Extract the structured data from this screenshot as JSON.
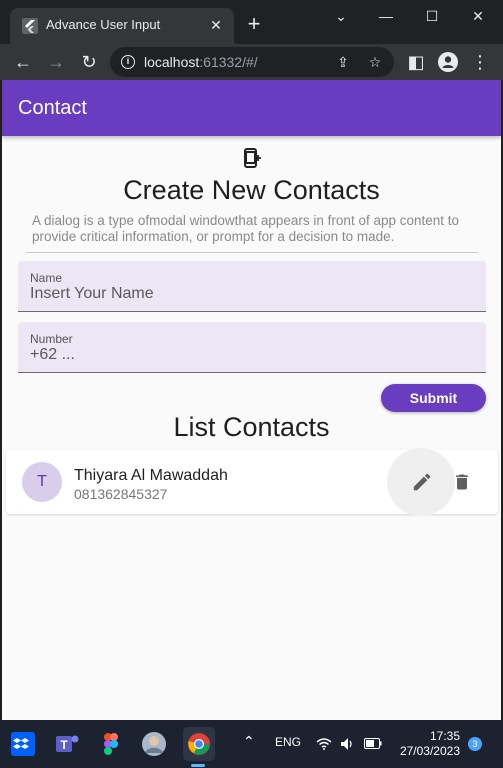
{
  "browser": {
    "tab_title": "Advance User Input",
    "url_host": "localhost",
    "url_rest": ":61332/#/"
  },
  "app": {
    "appbar_title": "Contact",
    "hero_title": "Create New Contacts",
    "hero_description": "A dialog is a type ofmodal windowthat appears in front of app content to provide critical information, or prompt for a decision to made.",
    "form": {
      "name_label": "Name",
      "name_placeholder": "Insert Your Name",
      "number_label": "Number",
      "number_placeholder": "+62 ...",
      "submit_label": "Submit"
    },
    "list_title": "List Contacts",
    "contacts": [
      {
        "initial": "T",
        "name": "Thiyara Al Mawaddah",
        "phone": "081362845327"
      }
    ]
  },
  "taskbar": {
    "language": "ENG",
    "time": "17:35",
    "date": "27/03/2023",
    "notification_count": "3"
  },
  "colors": {
    "primary": "#6a3cc0",
    "field_fill": "#ede6f5",
    "taskbar": "#1c2230"
  }
}
